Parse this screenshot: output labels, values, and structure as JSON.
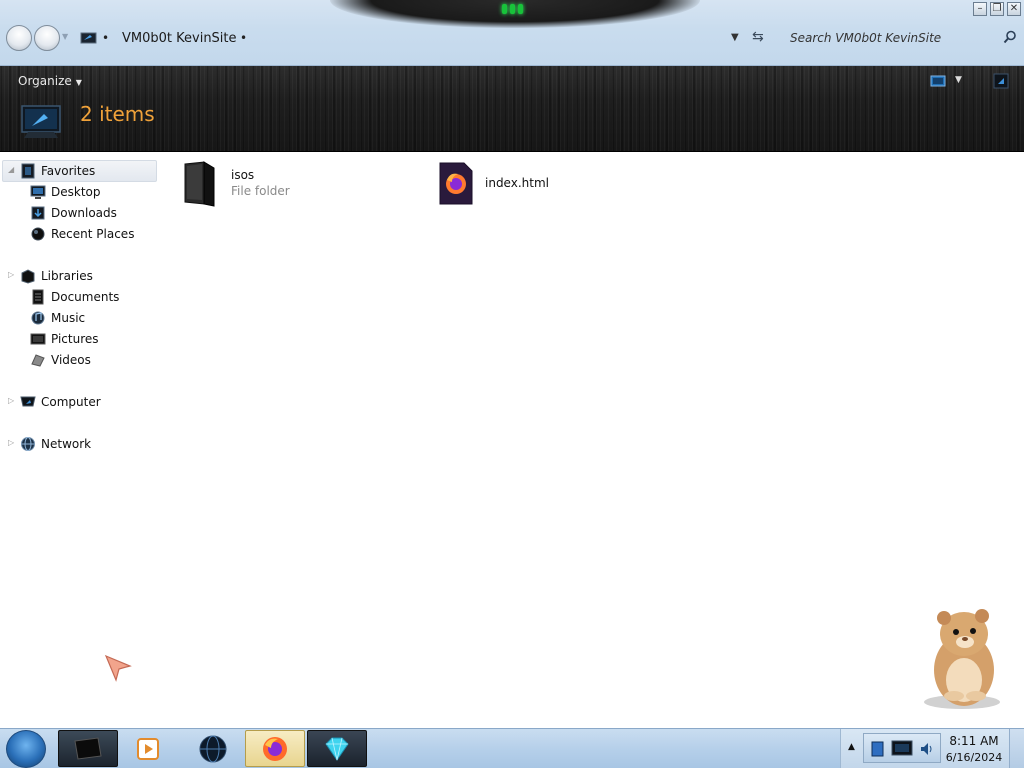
{
  "window": {
    "minimize_label": "–",
    "maximize_label": "❐",
    "close_label": "✕"
  },
  "address_bar": {
    "path": "VM0b0t KevinSite",
    "separator": "•",
    "search_placeholder": "Search VM0b0t KevinSite"
  },
  "command_bar": {
    "organize_label": "Organize",
    "item_count": "2 items"
  },
  "sidebar": {
    "favorites": {
      "label": "Favorites",
      "items": [
        "Desktop",
        "Downloads",
        "Recent Places"
      ]
    },
    "libraries": {
      "label": "Libraries",
      "items": [
        "Documents",
        "Music",
        "Pictures",
        "Videos"
      ]
    },
    "computer": {
      "label": "Computer"
    },
    "network": {
      "label": "Network"
    }
  },
  "files": [
    {
      "name": "isos",
      "type": "File folder",
      "icon": "folder-icon"
    },
    {
      "name": "index.html",
      "type": "",
      "icon": "firefox-html-icon"
    }
  ],
  "taskbar": {
    "apps": [
      "explorer-icon",
      "media-player-icon",
      "globe-icon",
      "firefox-icon",
      "diamond-icon"
    ],
    "clock_time": "8:11 AM",
    "clock_date": "6/16/2024"
  },
  "colors": {
    "command_bar_bg": "#1e1e1e",
    "item_count_text": "#f0a23a",
    "title_bar_bg": "#c9dcee",
    "taskbar_bg": "#b6d0ea"
  }
}
